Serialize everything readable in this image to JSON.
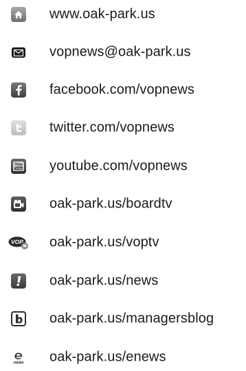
{
  "links": [
    {
      "icon": "home-icon",
      "text": "www.oak-park.us"
    },
    {
      "icon": "mail-icon",
      "text": "vopnews@oak-park.us"
    },
    {
      "icon": "facebook-icon",
      "text": "facebook.com/vopnews"
    },
    {
      "icon": "twitter-icon",
      "text": "twitter.com/vopnews"
    },
    {
      "icon": "youtube-icon",
      "text": "youtube.com/vopnews"
    },
    {
      "icon": "board-tv-icon",
      "text": "oak-park.us/boardtv"
    },
    {
      "icon": "vop-tv-icon",
      "text": "oak-park.us/voptv"
    },
    {
      "icon": "news-icon",
      "text": "oak-park.us/news"
    },
    {
      "icon": "blog-icon",
      "text": "oak-park.us/managersblog"
    },
    {
      "icon": "enews-icon",
      "text": "oak-park.us/enews"
    }
  ],
  "icon_text": {
    "youtube_top": "You",
    "youtube_bottom": "Tube",
    "vop": "VOP",
    "enews": "news"
  }
}
